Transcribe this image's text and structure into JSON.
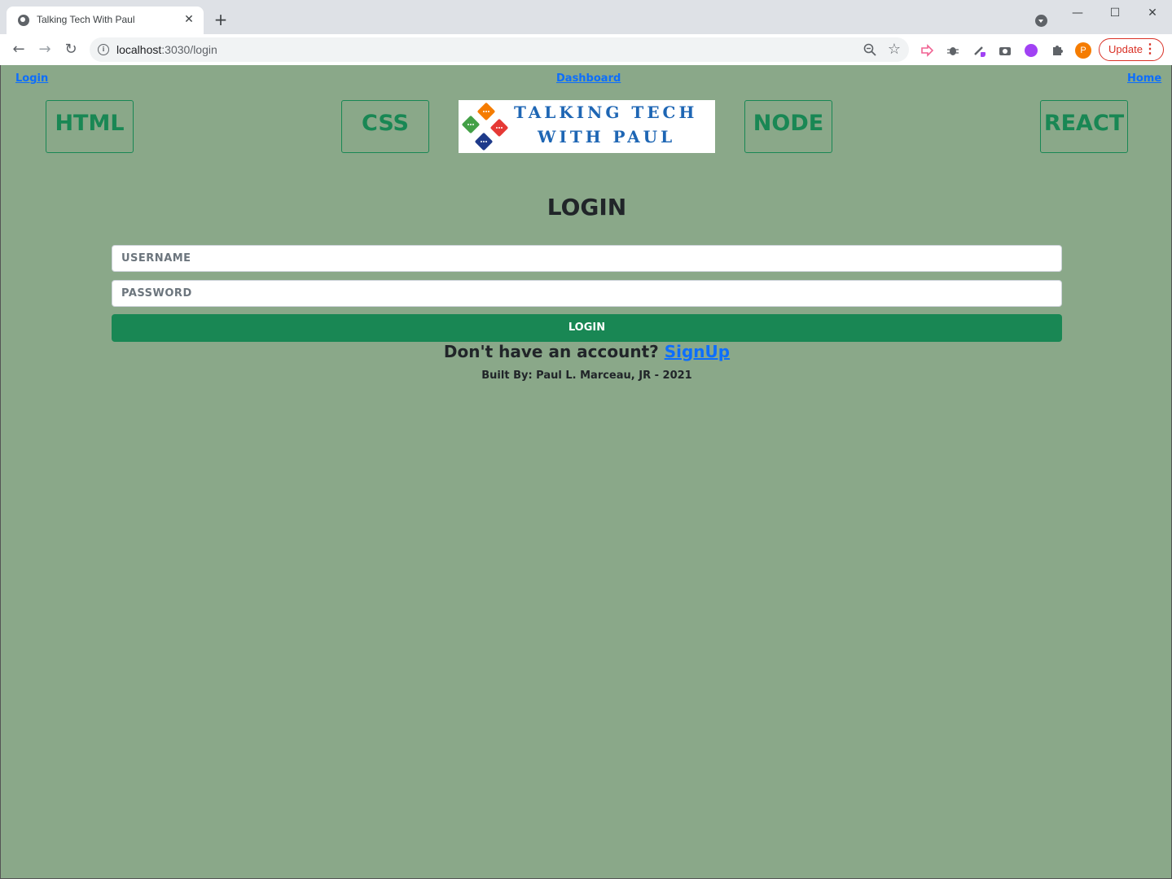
{
  "browser": {
    "tab_title": "Talking Tech With Paul",
    "tab_close": "✕",
    "new_tab": "+",
    "url_host": "localhost",
    "url_rest": ":3030/login",
    "update_label": "Update",
    "profile_initial": "P",
    "window": {
      "minimize": "—",
      "maximize": "☐",
      "close": "✕"
    }
  },
  "nav": {
    "login": "Login",
    "dashboard": "Dashboard",
    "home": "Home"
  },
  "tiles": [
    "HTML",
    "CSS",
    "NODE",
    "REACT"
  ],
  "logo": {
    "line1": "TALKING TECH",
    "line2": "WITH PAUL",
    "colors": [
      "#f57c00",
      "#43a047",
      "#e53935",
      "#1e3a8a"
    ]
  },
  "login": {
    "title": "LOGIN",
    "username_placeholder": "USERNAME",
    "password_placeholder": "PASSWORD",
    "button": "LOGIN",
    "prompt": "Don't have an account?",
    "signup": "SignUp"
  },
  "footer": "Built By: Paul L. Marceau, JR - 2021",
  "colors": {
    "background": "#8aa889",
    "accent": "#198754",
    "link": "#0d6efd"
  }
}
